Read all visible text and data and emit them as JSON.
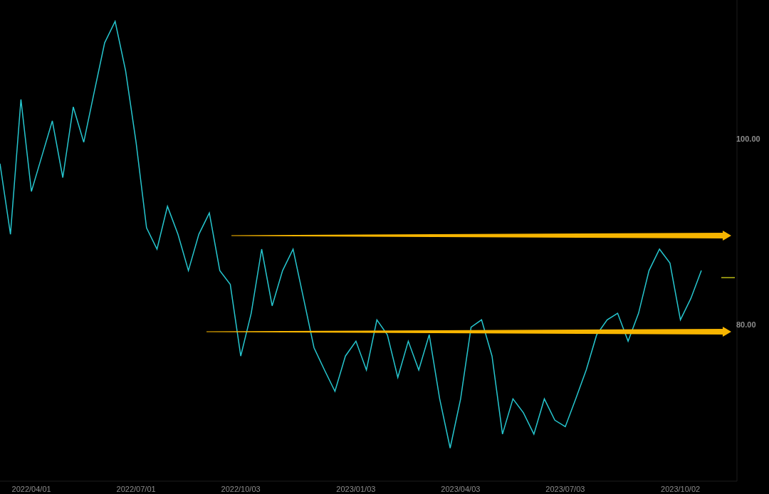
{
  "chart_data": {
    "type": "line",
    "ylim": [
      63.6,
      114.9
    ],
    "yticks": [
      {
        "value": 80,
        "label": "80.00"
      },
      {
        "value": 100,
        "label": "100.00"
      }
    ],
    "categories": [
      null,
      null,
      null,
      "2022/04/01",
      null,
      null,
      null,
      null,
      null,
      null,
      null,
      null,
      null,
      "2022/07/01",
      null,
      null,
      null,
      null,
      null,
      null,
      null,
      null,
      null,
      "2022/10/03",
      null,
      null,
      null,
      null,
      null,
      null,
      null,
      null,
      null,
      null,
      "2023/01/03",
      null,
      null,
      null,
      null,
      null,
      null,
      null,
      null,
      null,
      "2023/04/03",
      null,
      null,
      null,
      null,
      null,
      null,
      null,
      null,
      null,
      "2023/07/03",
      null,
      null,
      null,
      null,
      null,
      null,
      null,
      null,
      null,
      null,
      "2023/10/02",
      null,
      null
    ],
    "series": [
      {
        "color": "#26c6cf",
        "values": [
          97.3,
          89.7,
          104.2,
          94.3,
          98.1,
          101.9,
          95.8,
          103.4,
          99.6,
          105,
          110.3,
          112.6,
          107.3,
          99.6,
          90.4,
          88.1,
          92.7,
          89.7,
          85.8,
          89.7,
          92,
          85.8,
          84.3,
          76.6,
          81.2,
          88.1,
          82,
          85.8,
          88.1,
          82.8,
          77.5,
          75.1,
          72.8,
          76.6,
          78.2,
          75.1,
          80.5,
          78.9,
          74.3,
          78.2,
          75.1,
          78.9,
          72,
          66.7,
          72,
          79.7,
          80.5,
          76.6,
          68.2,
          72,
          70.5,
          68.2,
          72,
          69.7,
          69,
          72,
          75.1,
          78.9,
          80.5,
          81.2,
          78.2,
          81.2,
          85.8,
          88.1,
          86.6,
          80.5,
          82.8,
          85.8
        ]
      }
    ]
  },
  "overlays": [
    {
      "kind": "arrow",
      "color": "#f7b500"
    },
    {
      "kind": "arrow",
      "color": "#f7b500"
    },
    {
      "kind": "price-marker",
      "color": "#8a8a10"
    }
  ]
}
